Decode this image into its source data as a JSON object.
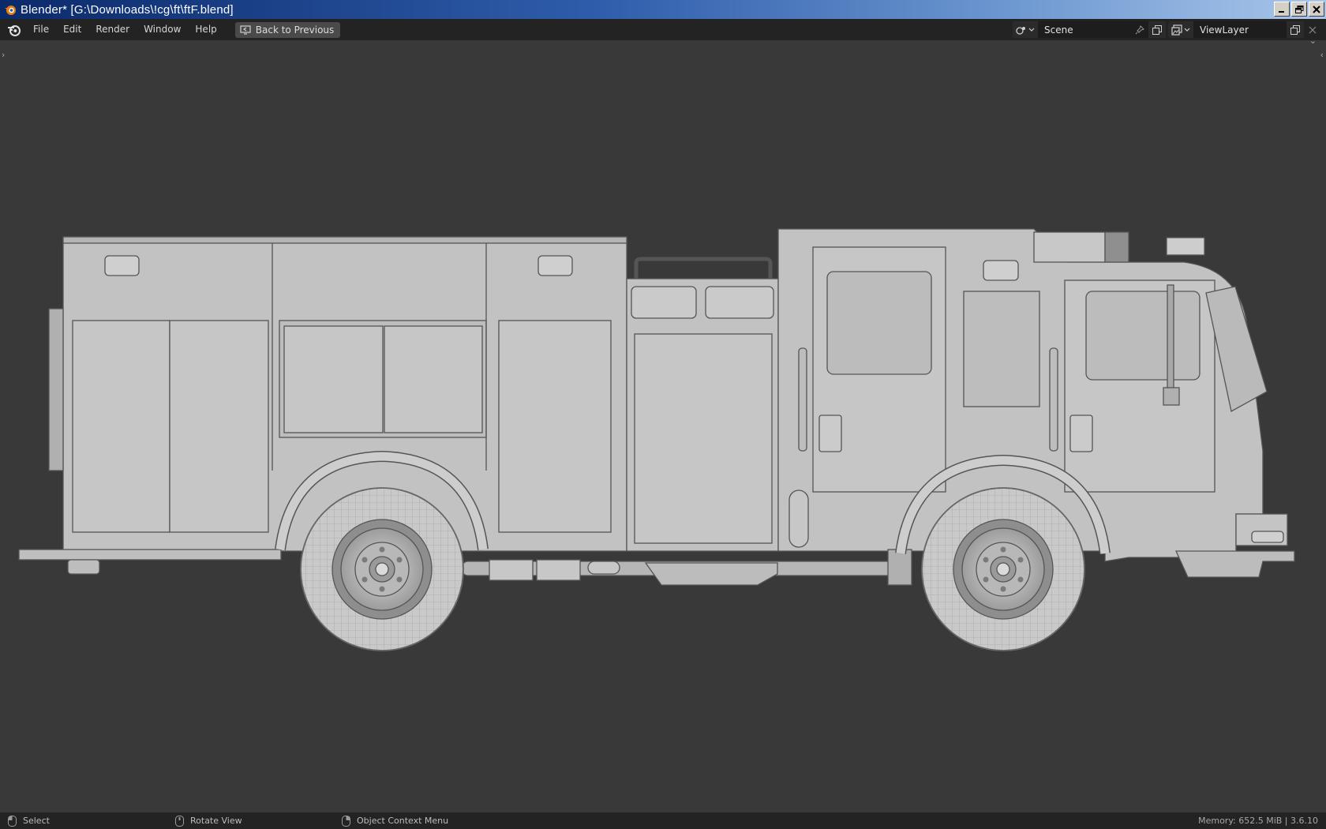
{
  "window": {
    "title": "Blender* [G:\\Downloads\\!cg\\ft\\ftF.blend]",
    "controls": [
      "minimize",
      "restore",
      "close"
    ]
  },
  "menubar": {
    "items": [
      "File",
      "Edit",
      "Render",
      "Window",
      "Help"
    ],
    "back_button": "Back to Previous",
    "scene_value": "Scene",
    "view_layer_value": "ViewLayer"
  },
  "viewport": {
    "content": "Fire truck 3D model, side orthographic view, solid shading"
  },
  "statusbar": {
    "left_click": "Select",
    "middle_click": "Rotate View",
    "right_click": "Object Context Menu",
    "memory": "Memory: 652.5 MiB | 3.6.10"
  },
  "colors": {
    "accent": "#e87d0d",
    "viewport_bg": "#393939",
    "header_bg": "#232323",
    "model": "#c2c2c2"
  }
}
